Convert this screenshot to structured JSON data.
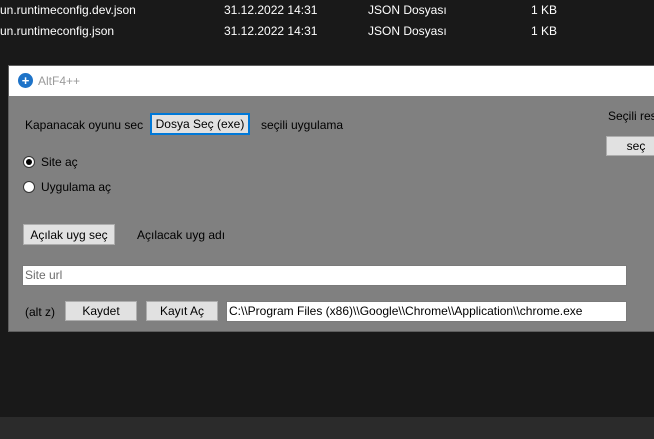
{
  "explorer": {
    "rows": [
      {
        "name": "un.runtimeconfig.dev.json",
        "date": "31.12.2022 14:31",
        "type": "JSON Dosyası",
        "size": "1 KB"
      },
      {
        "name": "un.runtimeconfig.json",
        "date": "31.12.2022 14:31",
        "type": "JSON Dosyası",
        "size": "1 KB"
      }
    ]
  },
  "window": {
    "title": "AltF4++",
    "icon": "altf4-app-icon",
    "game_label": "Kapanacak oyunu sec",
    "choose_file_button": "Dosya Seç (exe)",
    "selected_app_label": "seçili uygulama",
    "selected_res_label": "Seçili res",
    "res_select_button": "seç",
    "radio_site": {
      "label": "Site aç",
      "checked": true
    },
    "radio_app": {
      "label": "Uygulama aç",
      "checked": false
    },
    "open_app_button": "Açılak uyg seç",
    "open_app_name_label": "Açılacak uyg adı",
    "site_url_placeholder": "Site url",
    "hotkey_label": "(alt z)",
    "save_button": "Kaydet",
    "open_record_button": "Kayıt Aç",
    "path_value": "C:\\\\Program Files (x86)\\\\Google\\\\Chrome\\\\Application\\\\chrome.exe"
  },
  "colors": {
    "desktop_bg": "#191919",
    "window_bg": "#808080",
    "accent": "#0078d7"
  }
}
